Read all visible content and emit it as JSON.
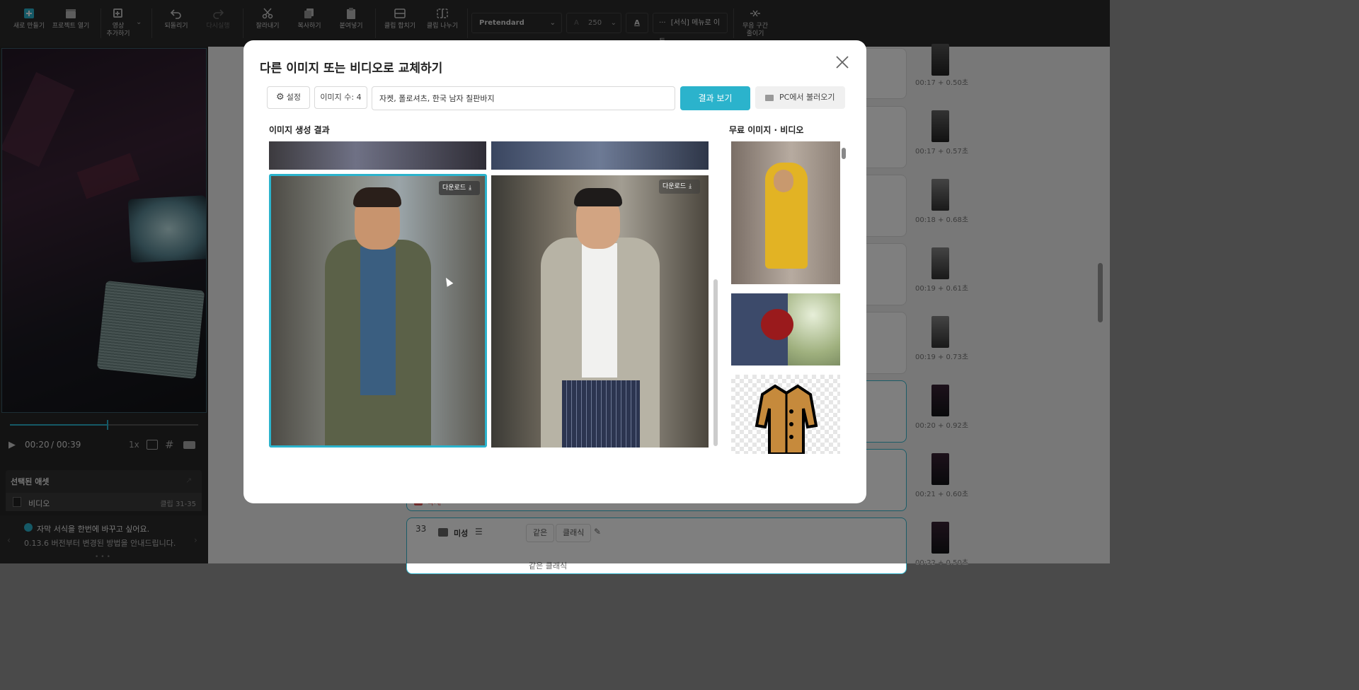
{
  "toolbar": {
    "items": [
      {
        "label": "새로 만들기"
      },
      {
        "label": "프로젝트 열기"
      },
      {
        "label1": "영상",
        "label2": "추가하기"
      },
      {
        "label": "되돌리기"
      },
      {
        "label": "다시실행"
      },
      {
        "label": "잘라내기"
      },
      {
        "label": "복사하기"
      },
      {
        "label": "붙여넣기"
      },
      {
        "label": "클립 합치기"
      },
      {
        "label": "클립 나누기"
      }
    ],
    "font_name": "Pretendard",
    "font_size": "250",
    "format_menu": "[서식] 메뉴로 이동",
    "silence": {
      "label1": "무음 구간",
      "label2": "줄이기"
    }
  },
  "player": {
    "current_time": "00:20",
    "total_time": "/ 00:39",
    "speed": "1x",
    "progress": 0.52
  },
  "selected_asset": {
    "title": "선택된 애셋",
    "name": "비디오",
    "clip": "클립 31-35"
  },
  "tip": {
    "title": "자막 서식을 한번에 바꾸고 싶어요.",
    "body": "0.13.6 버전부터 변경된 방법을 안내드립니다."
  },
  "timeline": {
    "timestamps": [
      "00:17 + 0.50초",
      "00:17 + 0.57초",
      "00:18 + 0.68초",
      "00:19 + 0.61초",
      "00:19 + 0.73초",
      "00:20 + 0.92초",
      "00:21 + 0.60초",
      "00:22 + 0.50초"
    ],
    "card_number": "33",
    "voice_label": "미성",
    "chip_same": "같은",
    "chip_classic": "클래식",
    "delete_label": "삭제",
    "bottom_text": "같은 클래식"
  },
  "modal": {
    "title": "다른 이미지 또는 비디오로 교체하기",
    "settings_label": "설정",
    "image_count": "이미지 수: 4",
    "prompt_value": "자켓, 폴로셔츠, 한국 남자 칠판바지",
    "results_button": "결과 보기",
    "pc_button": "PC에서 불러오기",
    "results_title": "이미지 생성 결과",
    "free_title": "무료 이미지 · 비디오",
    "download_label": "다운로드"
  },
  "colors": {
    "accent": "#2bb3cc",
    "toolbar_bg": "#2a2a2a"
  }
}
